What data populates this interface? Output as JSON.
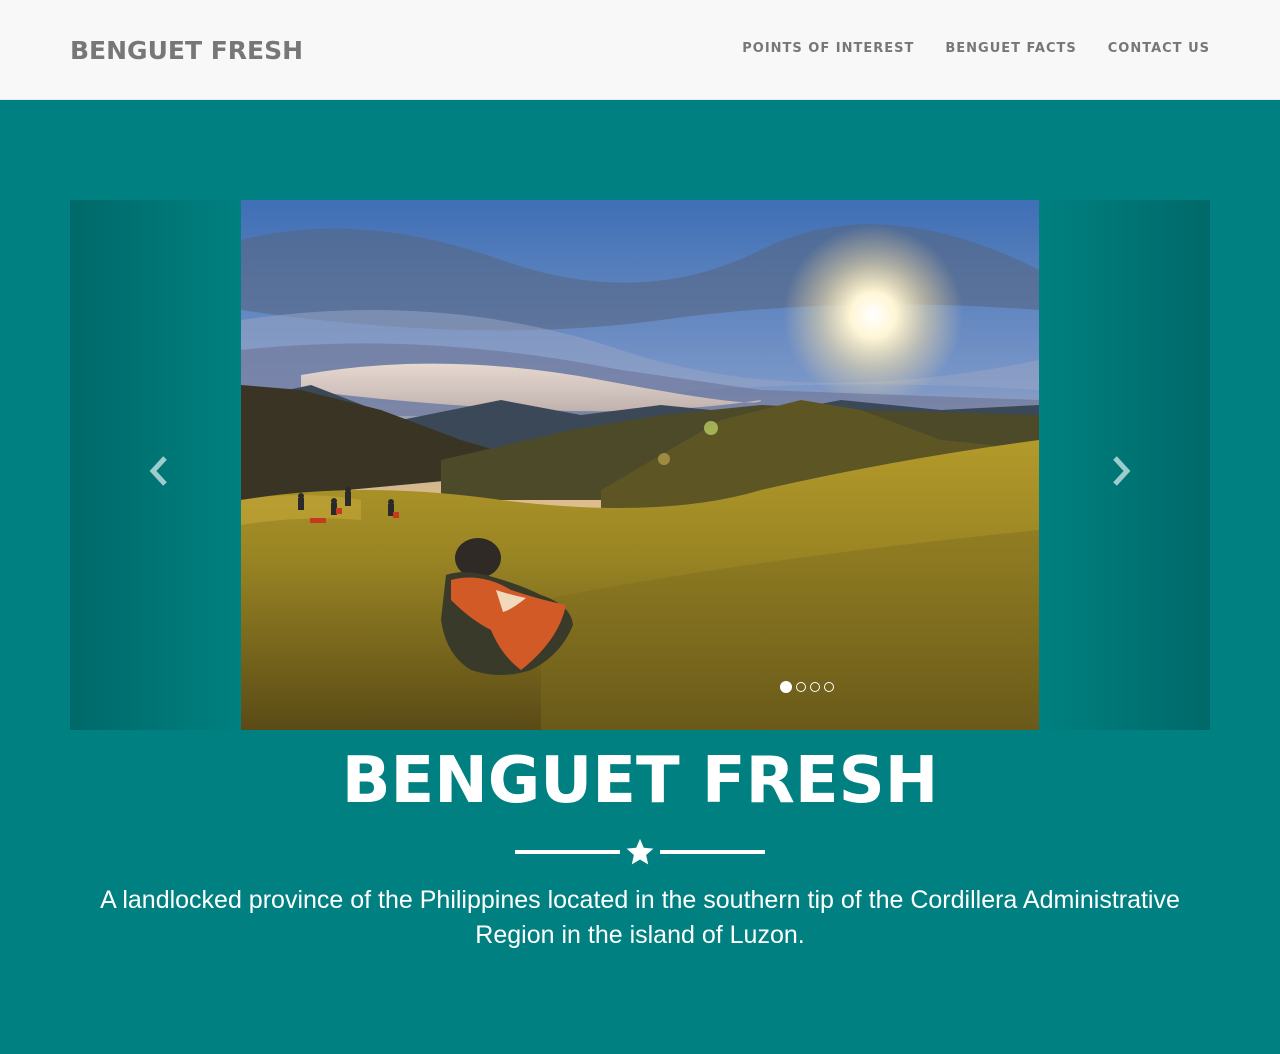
{
  "navbar": {
    "brand": "BENGUET FRESH",
    "links": [
      {
        "label": "POINTS OF INTEREST"
      },
      {
        "label": "BENGUET FACTS"
      },
      {
        "label": "CONTACT US"
      }
    ]
  },
  "carousel": {
    "slide_count": 4,
    "active_index": 0,
    "prev_icon": "chevron-left-icon",
    "next_icon": "chevron-right-icon"
  },
  "hero": {
    "title": "BENGUET FRESH",
    "divider_icon": "star-icon",
    "tagline": "A landlocked province of the Philippines located in the southern tip of the Cordillera Administrative Region in the island of Luzon."
  },
  "colors": {
    "background": "#008080",
    "navbar": "#f8f8f8",
    "nav_text": "#777777",
    "hero_text": "#ffffff"
  }
}
